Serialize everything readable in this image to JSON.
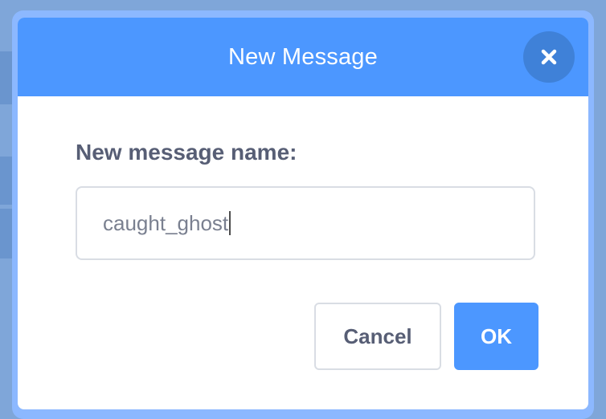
{
  "dialog": {
    "title": "New Message",
    "close_icon": "close-icon",
    "prompt_label": "New message name:",
    "input_value": "caught_ghost",
    "cancel_label": "Cancel",
    "ok_label": "OK"
  },
  "colors": {
    "header": "#4c97ff",
    "close_button": "#3f81d8",
    "text": "#575e75",
    "input_border": "#d9dde4"
  }
}
